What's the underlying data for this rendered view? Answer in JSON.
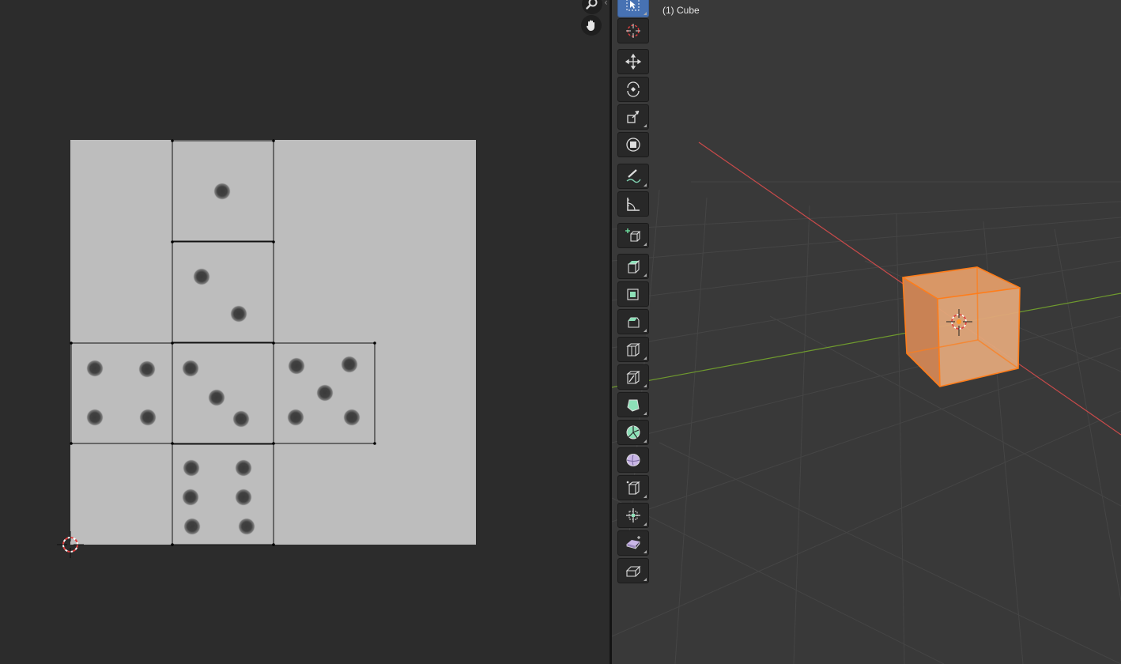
{
  "uv_editor": {
    "navigation": [
      {
        "name": "zoom-icon"
      },
      {
        "name": "hand-pan-icon"
      }
    ],
    "texture": "dice-uv-layout",
    "faces": [
      {
        "face": "one",
        "pips": 1
      },
      {
        "face": "two",
        "pips": 2
      },
      {
        "face": "four",
        "pips": 4
      },
      {
        "face": "three",
        "pips": 3
      },
      {
        "face": "five",
        "pips": 5
      },
      {
        "face": "six",
        "pips": 6
      }
    ]
  },
  "viewport": {
    "object_label": "(1) Cube",
    "selected_object": "Cube",
    "selection_color": "#ff8c1a",
    "x_axis_color": "#c84a4a",
    "y_axis_color": "#6f9a2e"
  },
  "toolbar": {
    "active_tool": "select-box",
    "tools": [
      "select-box-tool",
      "cursor-tool",
      "move-tool",
      "rotate-tool",
      "scale-tool",
      "transform-tool",
      "annotate-tool",
      "measure-tool",
      "add-cube-tool",
      "extrude-region-tool",
      "inset-faces-tool",
      "bevel-tool",
      "loop-cut-tool",
      "knife-tool",
      "poly-build-tool",
      "spin-tool",
      "smooth-tool",
      "edge-slide-tool",
      "shrink-fatten-tool",
      "shear-tool",
      "rip-region-tool"
    ]
  }
}
